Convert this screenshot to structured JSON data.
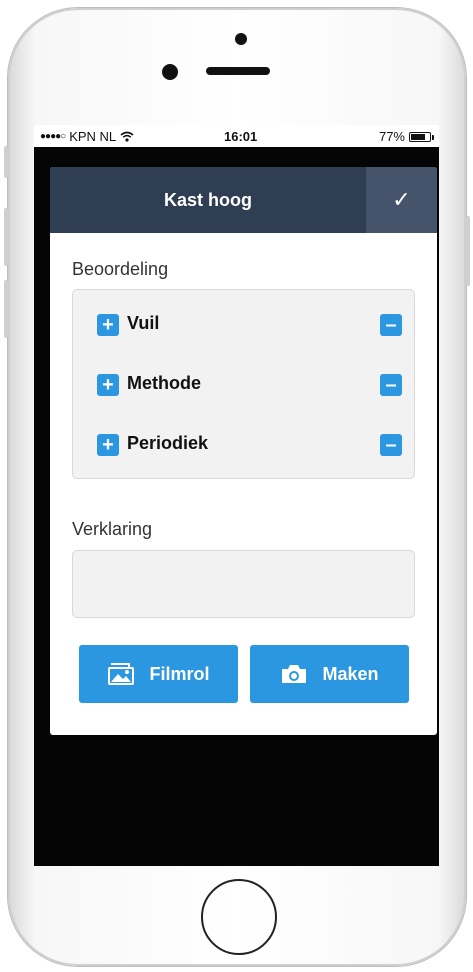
{
  "status_bar": {
    "signal_dots": "●●●●○",
    "carrier": "KPN NL",
    "wifi_icon": "wifi-icon",
    "time": "16:01",
    "battery_percent": "77%",
    "battery_level": 0.77
  },
  "dialog": {
    "title": "Kast hoog",
    "confirm_symbol": "✓"
  },
  "rating": {
    "label": "Beoordeling",
    "items": [
      {
        "label": "Vuil",
        "plus": "+",
        "minus": "–"
      },
      {
        "label": "Methode",
        "plus": "+",
        "minus": "–"
      },
      {
        "label": "Periodiek",
        "plus": "+",
        "minus": "–"
      }
    ]
  },
  "statement": {
    "label": "Verklaring",
    "value": "",
    "placeholder": ""
  },
  "actions": {
    "camera_roll_label": "Filmrol",
    "take_photo_label": "Maken"
  },
  "colors": {
    "header_bg": "#2f3e52",
    "confirm_bg": "#45546a",
    "accent_blue": "#2b97e0"
  }
}
